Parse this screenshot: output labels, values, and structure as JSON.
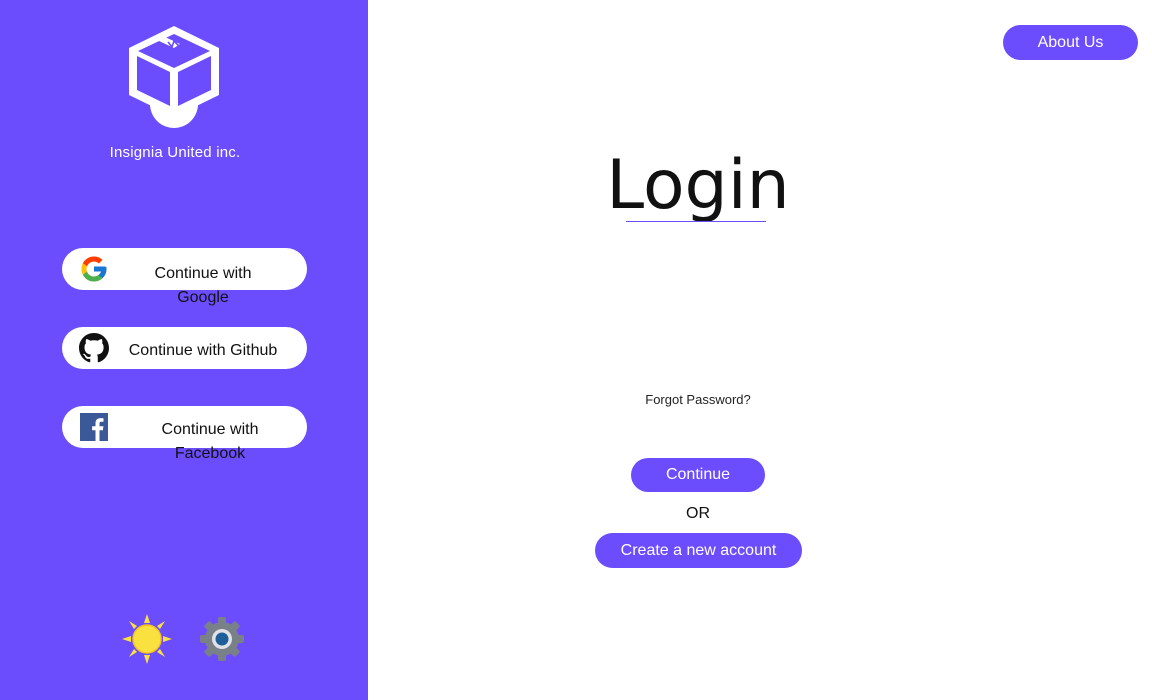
{
  "brand": {
    "company_name": "Insignia United inc.",
    "logo_icon": "box-logo-icon"
  },
  "social": [
    {
      "label": "Continue with Google",
      "icon": "google-icon"
    },
    {
      "label": "Continue with Github",
      "icon": "github-icon"
    },
    {
      "label": "Continue with Facebook",
      "icon": "facebook-icon"
    }
  ],
  "theme_controls": [
    {
      "icon": "sun-icon"
    },
    {
      "icon": "gear-icon"
    }
  ],
  "header": {
    "about_label": "About Us"
  },
  "login": {
    "title": "Login",
    "forgot_label": "Forgot Password?",
    "continue_label": "Continue",
    "or_label": "OR",
    "create_label": "Create a new account"
  },
  "colors": {
    "accent": "#6b4dfd",
    "background": "#ffffff",
    "sun": "#fbe140",
    "gear": "#7a8088"
  }
}
